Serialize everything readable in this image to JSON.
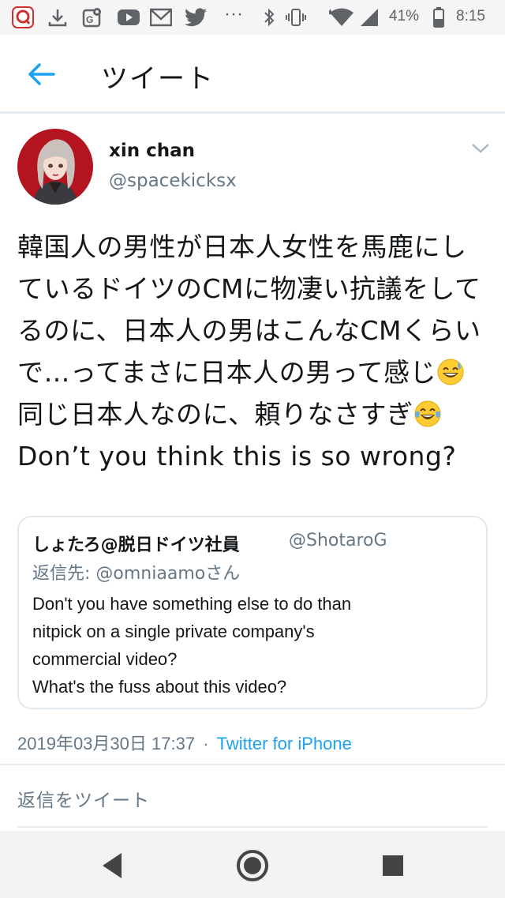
{
  "status_bar": {
    "battery": "41%",
    "time": "8:15",
    "left_icons": [
      "app-notification-icon",
      "download-icon",
      "maps-icon",
      "youtube-icon",
      "gmail-icon",
      "twitter-icon",
      "more-dots-icon"
    ],
    "right_icons": [
      "bluetooth-icon",
      "vibrate-icon",
      "wifi-icon",
      "signal-icon",
      "battery-icon"
    ]
  },
  "header": {
    "title": "ツイート",
    "back_icon": "arrow-left-icon"
  },
  "tweet": {
    "author_name": "xin chan",
    "author_handle": "@spacekicksx",
    "text_part1": "韓国人の男性が日本人女性を馬鹿にしているドイツのCMに物凄い抗議をしてるのに、日本人の男はこんなCMくらいで…ってまさに日本人の男って感じ",
    "text_part2": "同じ日本人なのに、頼りなさすぎ",
    "text_part3": " Don’t you think this is so wrong?",
    "emoji_1": "grinning-sweat-emoji",
    "emoji_2": "tears-of-joy-emoji",
    "timestamp": "2019年03月30日 17:37",
    "separator": "·",
    "source": "Twitter for iPhone"
  },
  "quoted": {
    "name": "しょたろ@脱日ドイツ社員",
    "handle": "@ShotaroG",
    "reply_to": "返信先: @omniaamoさん",
    "lines": [
      "Don't you have something else to do than",
      "nitpick on a single private company's",
      "commercial video?",
      "What's the fuss about this video?"
    ]
  },
  "reply": {
    "placeholder": "返信をツイート"
  },
  "nav": {
    "icons": [
      "back-triangle-icon",
      "home-circle-icon",
      "recents-square-icon"
    ]
  },
  "colors": {
    "accent": "#1da1f2",
    "text": "#14171a",
    "muted": "#657786",
    "border": "#e1e8ed"
  }
}
